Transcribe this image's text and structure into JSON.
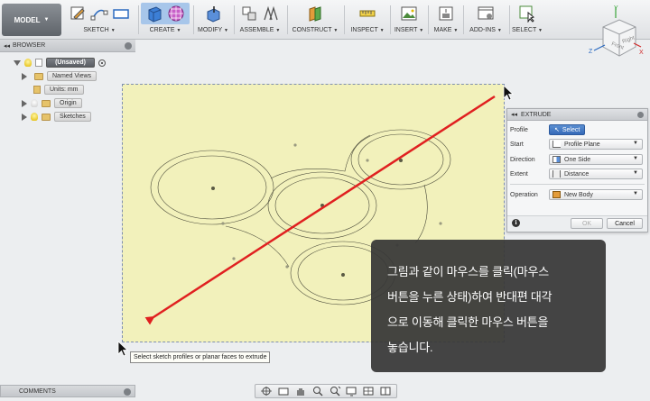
{
  "toolbar": {
    "workspace": "MODEL",
    "groups": [
      {
        "label": "SKETCH"
      },
      {
        "label": "CREATE"
      },
      {
        "label": "MODIFY"
      },
      {
        "label": "ASSEMBLE"
      },
      {
        "label": "CONSTRUCT"
      },
      {
        "label": "INSPECT"
      },
      {
        "label": "INSERT"
      },
      {
        "label": "MAKE"
      },
      {
        "label": "ADD-INS"
      },
      {
        "label": "SELECT"
      }
    ]
  },
  "viewcube": {
    "front": "Front",
    "right": "Right",
    "axis_x": "X",
    "axis_y": "Y",
    "axis_z": "Z"
  },
  "browser": {
    "title": "BROWSER",
    "root": "(Unsaved)",
    "items": [
      {
        "label": "Named Views"
      },
      {
        "label": "Units: mm"
      },
      {
        "label": "Origin"
      },
      {
        "label": "Sketches"
      }
    ]
  },
  "extrude": {
    "title": "EXTRUDE",
    "rows": [
      {
        "label": "Profile",
        "value": "Select"
      },
      {
        "label": "Start",
        "value": "Profile Plane"
      },
      {
        "label": "Direction",
        "value": "One Side"
      },
      {
        "label": "Extent",
        "value": "Distance"
      },
      {
        "label": "Operation",
        "value": "New Body"
      }
    ],
    "ok": "OK",
    "cancel": "Cancel"
  },
  "tooltip": "Select sketch profiles or planar faces to extrude",
  "callout": {
    "lines": [
      "그림과 같이 마우스를 클릭(마우스",
      "버튼을 누른 상태)하여 반대편 대각",
      "으로 이동해 클릭한 마우스 버튼을",
      "놓습니다."
    ]
  },
  "comments": {
    "title": "COMMENTS"
  },
  "colors": {
    "sketch_fill": "#f2f1bb",
    "arrow": "#e02020",
    "selection_border": "#7f8fb0",
    "select_button": "#3b74c2"
  }
}
